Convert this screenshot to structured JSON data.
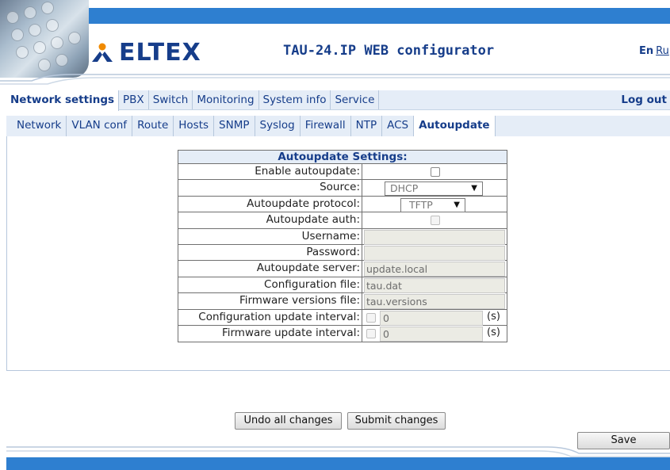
{
  "header": {
    "logo_text": "ELTEX",
    "product_title": "TAU-24.IP WEB configurator",
    "lang_current": "En",
    "lang_alt": "Ru"
  },
  "main_tabs": [
    {
      "label": "Network settings",
      "active": true
    },
    {
      "label": "PBX"
    },
    {
      "label": "Switch"
    },
    {
      "label": "Monitoring"
    },
    {
      "label": "System info"
    },
    {
      "label": "Service"
    }
  ],
  "logout_label": "Log out",
  "sub_tabs": [
    {
      "label": "Network"
    },
    {
      "label": "VLAN conf"
    },
    {
      "label": "Route"
    },
    {
      "label": "Hosts"
    },
    {
      "label": "SNMP"
    },
    {
      "label": "Syslog"
    },
    {
      "label": "Firewall"
    },
    {
      "label": "NTP"
    },
    {
      "label": "ACS"
    },
    {
      "label": "Autoupdate",
      "active": true
    }
  ],
  "settings": {
    "title": "Autoupdate Settings:",
    "enable_label": "Enable autoupdate:",
    "source_label": "Source:",
    "source_value": "DHCP",
    "protocol_label": "Autoupdate protocol:",
    "protocol_value": "TFTP",
    "auth_label": "Autoupdate auth:",
    "username_label": "Username:",
    "username_value": "",
    "password_label": "Password:",
    "password_value": "",
    "server_label": "Autoupdate server:",
    "server_value": "update.local",
    "config_file_label": "Configuration file:",
    "config_file_value": "tau.dat",
    "fw_file_label": "Firmware versions file:",
    "fw_file_value": "tau.versions",
    "config_interval_label": "Configuration update interval:",
    "config_interval_value": "0",
    "fw_interval_label": "Firmware update interval:",
    "fw_interval_value": "0",
    "unit": "(s)"
  },
  "buttons": {
    "undo": "Undo all changes",
    "submit": "Submit changes",
    "save": "Save"
  },
  "colors": {
    "brand_blue": "#2e7fd0",
    "text_blue": "#163d8a",
    "tab_bg": "#e5edf7"
  }
}
